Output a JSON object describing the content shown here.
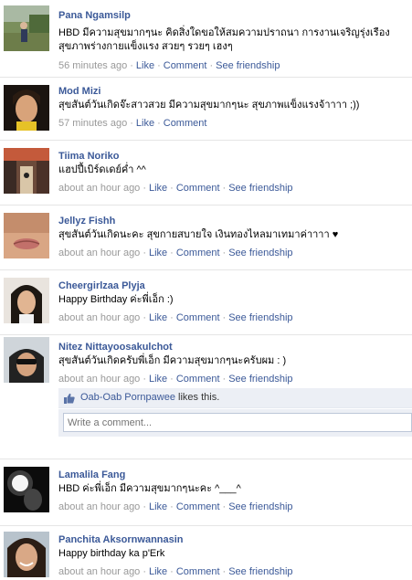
{
  "posts": [
    {
      "name": "Pana Ngamsilp",
      "message": "HBD มีความสุขมากๆนะ คิดสิ่งใดขอให้สมความปราถนา การงานเจริญรุ่งเรือง สุขภาพร่างกายแข็งแรง สวยๆ รวยๆ เฮงๆ",
      "time": "56 minutes ago",
      "like": "Like",
      "comment": "Comment",
      "friendship": "See friendship",
      "avatar_icon": "avatar-photo-outdoor"
    },
    {
      "name": "Mod Mizi",
      "message": "สุขสันต์วันเกิดจ๊ะสาวสวย มีความสุขมากๆนะ สุขภาพแข็งแรงจ้าาาา ;))",
      "time": "57 minutes ago",
      "like": "Like",
      "comment": "Comment",
      "friendship": "",
      "avatar_icon": "avatar-photo-portrait"
    },
    {
      "name": "Tiima Noriko",
      "message": "แฮปปี้เบิร์ดเดย์ค่ำ ^^",
      "time": "about an hour ago",
      "like": "Like",
      "comment": "Comment",
      "friendship": "See friendship",
      "avatar_icon": "avatar-photo-street"
    },
    {
      "name": "Jellyz Fishh",
      "message": "สุขสันต์วันเกิดนะคะ สุขกายสบายใจ เงินทองไหลมาเทมาค่าาาา ♥",
      "time": "about an hour ago",
      "like": "Like",
      "comment": "Comment",
      "friendship": "See friendship",
      "avatar_icon": "avatar-photo-lips"
    },
    {
      "name": "Cheergirlzaa Plyja",
      "message": "Happy Birthday ค่ะพี่เอ็ก :)",
      "time": "about an hour ago",
      "like": "Like",
      "comment": "Comment",
      "friendship": "See friendship",
      "avatar_icon": "avatar-photo-girl"
    },
    {
      "name": "Nitez Nittayoosakulchot",
      "message": "สุขสันต์วันเกิดครับพี่เอ็ก มีความสุขมากๆนะครับผม : )",
      "time": "about an hour ago",
      "like": "Like",
      "comment": "Comment",
      "friendship": "See friendship",
      "avatar_icon": "avatar-photo-sunglasses",
      "liked_by": "Oab-Oab Pornpawee",
      "likes_text": "likes this.",
      "comment_placeholder": "Write a comment..."
    },
    {
      "name": "Lamalila Fang",
      "message": "HBD ค่ะพี่เอ็ก มีความสุขมากๆนะคะ ^___^",
      "time": "about an hour ago",
      "like": "Like",
      "comment": "Comment",
      "friendship": "See friendship",
      "avatar_icon": "avatar-photo-night"
    },
    {
      "name": "Panchita Aksornwannasin",
      "message": "Happy birthday ka p'Erk",
      "time": "about an hour ago",
      "like": "Like",
      "comment": "Comment",
      "friendship": "See friendship",
      "avatar_icon": "avatar-photo-smile"
    }
  ]
}
